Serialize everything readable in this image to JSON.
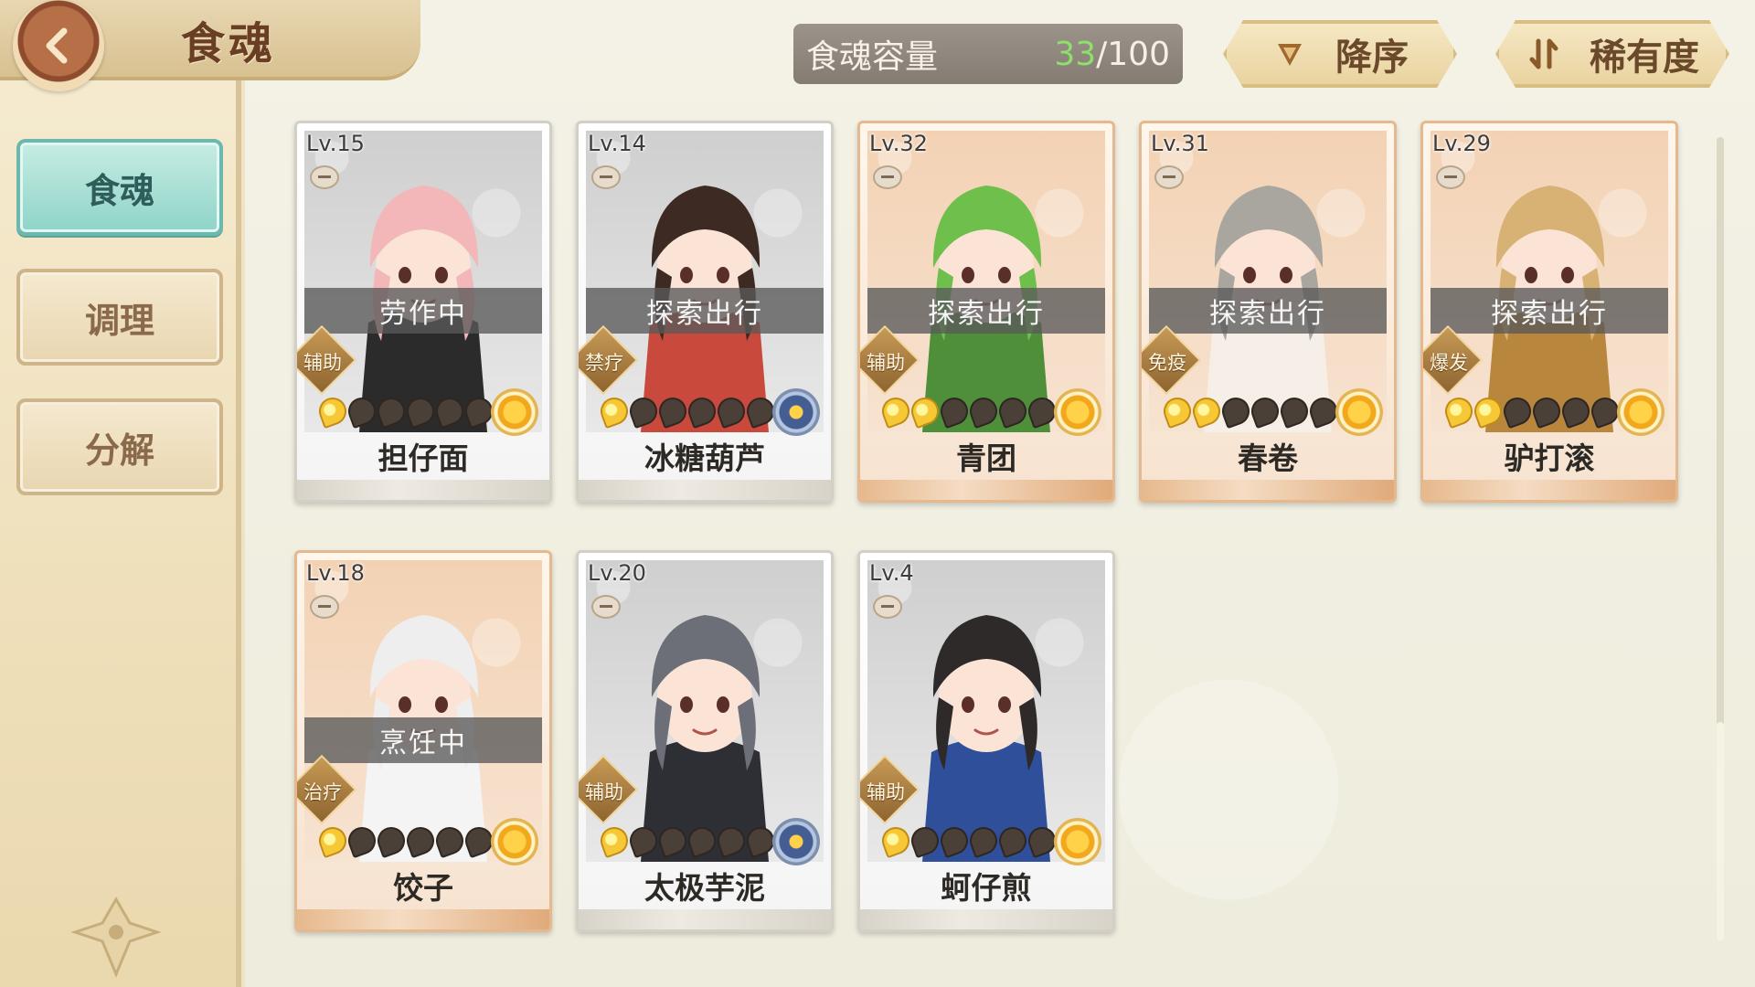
{
  "header": {
    "title": "食魂",
    "back_icon": "back-arrow-icon"
  },
  "sidebar": {
    "tabs": [
      {
        "label": "食魂",
        "active": true
      },
      {
        "label": "调理",
        "active": false
      },
      {
        "label": "分解",
        "active": false
      }
    ]
  },
  "capacity": {
    "label": "食魂容量",
    "current": "33",
    "separator": "/",
    "max": "100"
  },
  "sort": {
    "order_label": "降序",
    "order_icon": "triangle-down-icon",
    "rarity_label": "稀有度",
    "rarity_icon": "sort-arrows-icon"
  },
  "cards": [
    {
      "level": "Lv.15",
      "status": "劳作中",
      "role": "辅助",
      "name": "担仔面",
      "stars": 1,
      "element": "sun",
      "rarity": "silver",
      "hair": "#f3b7b9",
      "cloth": "#2b2b2b"
    },
    {
      "level": "Lv.14",
      "status": "探索出行",
      "role": "禁疗",
      "name": "冰糖葫芦",
      "stars": 1,
      "element": "water",
      "rarity": "silver",
      "hair": "#3d2a22",
      "cloth": "#c94a3c"
    },
    {
      "level": "Lv.32",
      "status": "探索出行",
      "role": "辅助",
      "name": "青团",
      "stars": 2,
      "element": "sun",
      "rarity": "gold",
      "hair": "#6fbf4d",
      "cloth": "#4f8f3a"
    },
    {
      "level": "Lv.31",
      "status": "探索出行",
      "role": "免疫",
      "name": "春卷",
      "stars": 2,
      "element": "sun",
      "rarity": "gold",
      "hair": "#a9a6a0",
      "cloth": "#f5efe7"
    },
    {
      "level": "Lv.29",
      "status": "探索出行",
      "role": "爆发",
      "name": "驴打滚",
      "stars": 2,
      "element": "sun",
      "rarity": "gold",
      "hair": "#d8b174",
      "cloth": "#b8863c"
    },
    {
      "level": "Lv.18",
      "status": "烹饪中",
      "role": "治疗",
      "name": "饺子",
      "stars": 1,
      "element": "sun",
      "rarity": "gold",
      "hair": "#eeeeee",
      "cloth": "#f4f4f4"
    },
    {
      "level": "Lv.20",
      "status": "",
      "role": "辅助",
      "name": "太极芋泥",
      "stars": 1,
      "element": "water",
      "rarity": "silver",
      "hair": "#6d6f78",
      "cloth": "#2e2e35"
    },
    {
      "level": "Lv.4",
      "status": "",
      "role": "辅助",
      "name": "蚵仔煎",
      "stars": 1,
      "element": "sun",
      "rarity": "silver",
      "hair": "#2e2a2a",
      "cloth": "#2f4f9a"
    }
  ]
}
